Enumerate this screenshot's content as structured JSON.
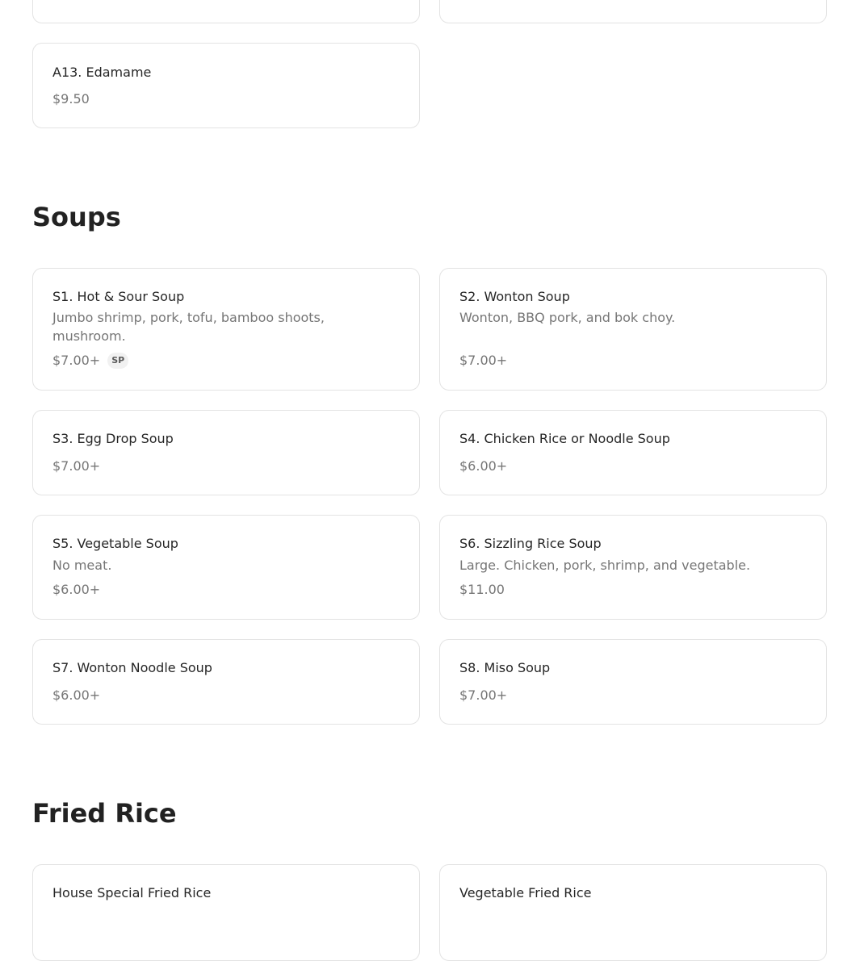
{
  "sections": {
    "appetizers": {
      "items": [
        {
          "name": "A13. Edamame",
          "price": "$9.50"
        }
      ]
    },
    "soups": {
      "title": "Soups",
      "items": [
        {
          "name": "S1. Hot & Sour Soup",
          "description": "Jumbo shrimp, pork, tofu, bamboo shoots, mushroom.",
          "price": "$7.00+",
          "badge": "SP"
        },
        {
          "name": "S2. Wonton Soup",
          "description": "Wonton, BBQ pork, and bok choy.",
          "price": "$7.00+"
        },
        {
          "name": "S3. Egg Drop Soup",
          "price": "$7.00+"
        },
        {
          "name": "S4. Chicken Rice or Noodle Soup",
          "price": "$6.00+"
        },
        {
          "name": "S5. Vegetable Soup",
          "description": "No meat.",
          "price": "$6.00+"
        },
        {
          "name": "S6. Sizzling Rice Soup",
          "description": "Large. Chicken, pork, shrimp, and vegetable.",
          "price": "$11.00"
        },
        {
          "name": "S7. Wonton Noodle Soup",
          "price": "$6.00+"
        },
        {
          "name": "S8. Miso Soup",
          "price": "$7.00+"
        }
      ]
    },
    "fried_rice": {
      "title": "Fried Rice",
      "items": [
        {
          "name": "House Special Fried Rice"
        },
        {
          "name": "Vegetable Fried Rice"
        }
      ]
    }
  }
}
